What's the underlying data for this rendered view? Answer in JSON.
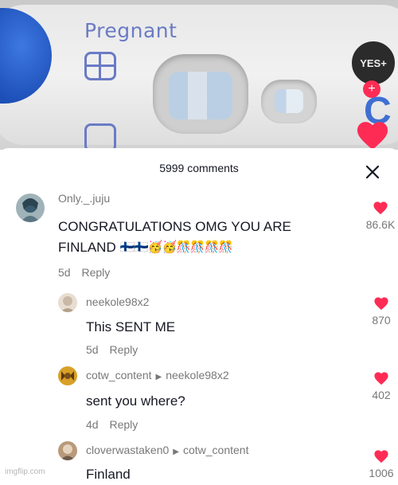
{
  "photo": {
    "test_brand_text": "Pregnant",
    "creator_avatar_label": "YES+",
    "follow_badge": "+",
    "side_letter": "C"
  },
  "comments_panel": {
    "title": "5999 comments",
    "close_icon": "close-icon"
  },
  "comments": [
    {
      "username": "Only._.juju",
      "text_line1": "CONGRATULATIONS OMG YOU ARE",
      "text_line2": "FINLAND",
      "text_line2_emojis": "🇫🇮🇫🇮🥳🥳🎊🎊🎊🎊",
      "age": "5d",
      "reply_label": "Reply",
      "likes": "86.6K",
      "avatar_colors": [
        "#3b5a6e",
        "#8aa4a8"
      ]
    },
    {
      "username": "neekole98x2",
      "text": "This SENT ME",
      "age": "5d",
      "reply_label": "Reply",
      "likes": "870",
      "avatar_colors": [
        "#c9b8a6",
        "#e8ddd0"
      ]
    },
    {
      "username": "cotw_content",
      "reply_to": "neekole98x2",
      "text": "sent you where?",
      "age": "4d",
      "reply_label": "Reply",
      "likes": "402",
      "avatar_colors": [
        "#d8a028",
        "#5a3a12"
      ]
    },
    {
      "username": "cloverwastaken0",
      "reply_to": "cotw_content",
      "text": "Finland",
      "likes": "1006",
      "avatar_colors": [
        "#b89a7a",
        "#6e5a48"
      ]
    }
  ],
  "colors": {
    "like_heart": "#fe2c55",
    "secondary_text": "#787878",
    "primary_text": "#161823"
  },
  "watermark": "imgflip.com"
}
